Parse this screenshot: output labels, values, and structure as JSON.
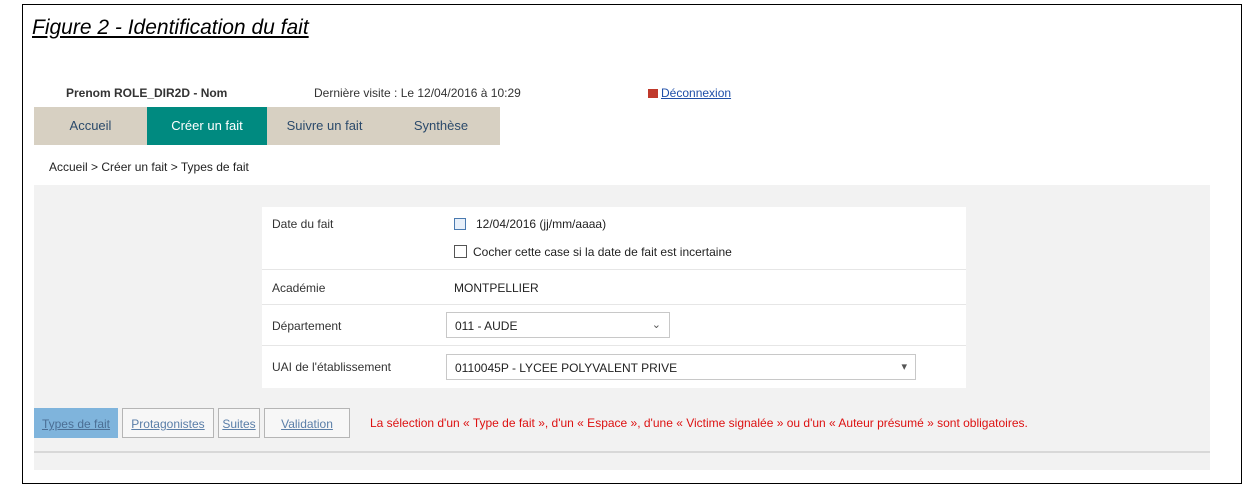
{
  "figure": {
    "title": "Figure 2 - Identification du fait"
  },
  "header": {
    "user": "Prenom ROLE_DIR2D - Nom",
    "last_visit": "Dernière visite : Le 12/04/2016 à 10:29",
    "logout": "Déconnexion"
  },
  "nav": {
    "items": [
      {
        "label": "Accueil"
      },
      {
        "label": "Créer un fait"
      },
      {
        "label": "Suivre un fait"
      },
      {
        "label": "Synthèse"
      }
    ],
    "active_index": 1
  },
  "breadcrumb": "Accueil > Créer un fait > Types de fait",
  "form": {
    "date_label": "Date du fait",
    "date_value": "12/04/2016",
    "date_hint": "(jj/mm/aaaa)",
    "uncertain_label": "Cocher cette case si la date de fait est incertaine",
    "academie_label": "Académie",
    "academie_value": "MONTPELLIER",
    "departement_label": "Département",
    "departement_value": "011 - AUDE",
    "uai_label": "UAI de l'établissement",
    "uai_value": "0110045P - LYCEE POLYVALENT PRIVE"
  },
  "tabs": {
    "items": [
      {
        "label": "Types de fait"
      },
      {
        "label": "Protagonistes"
      },
      {
        "label": "Suites"
      },
      {
        "label": "Validation"
      }
    ],
    "active_index": 0
  },
  "message": "La sélection d'un « Type de fait », d'un « Espace », d'une « Victime signalée » ou d'un « Auteur présumé » sont obligatoires.",
  "colors": {
    "nav_active": "#008a80",
    "nav_bg": "#d7d0c2",
    "tab_active": "#7fb4dc",
    "error": "#dd1111"
  }
}
